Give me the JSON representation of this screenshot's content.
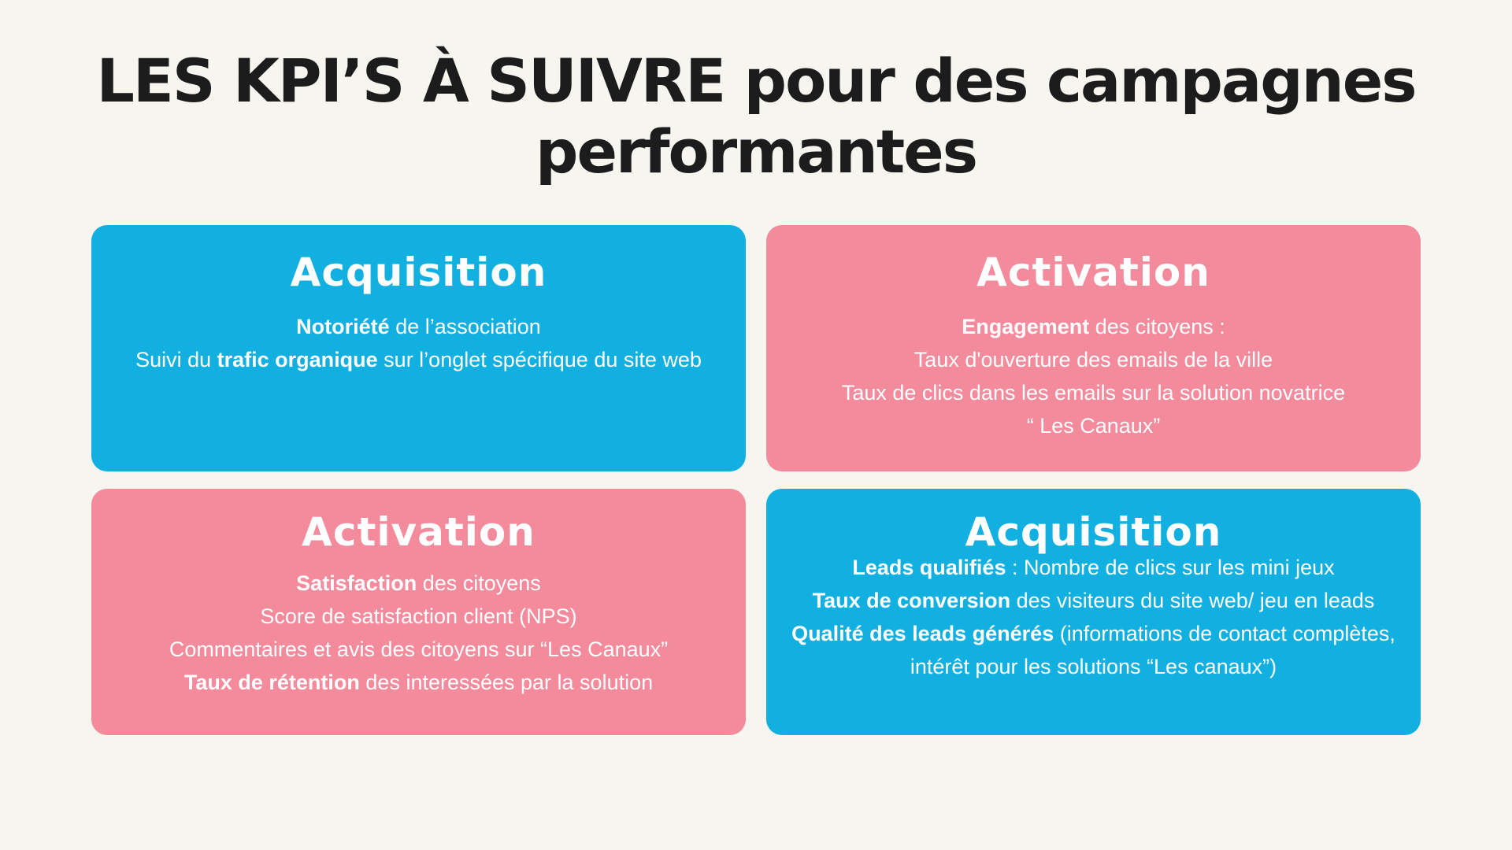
{
  "title": "LES KPI’S À SUIVRE pour des campagnes performantes",
  "cards": [
    {
      "title": "Acquisition",
      "color": "#12b0e0",
      "lines": [
        {
          "bold": "Notoriété",
          "text": " de l’association"
        },
        {
          "pre": "Suivi du ",
          "bold": "trafic organique",
          "text": " sur l’onglet spécifique du site web"
        }
      ]
    },
    {
      "title": "Activation",
      "color": "#f38b9c",
      "lines": [
        {
          "bold": "Engagement",
          "text": " des citoyens :"
        },
        {
          "text": "Taux d'ouverture des emails de la ville"
        },
        {
          "text": "Taux de clics dans les emails sur la solution novatrice"
        },
        {
          "text": "“ Les Canaux”"
        }
      ]
    },
    {
      "title": "Activation",
      "color": "#f38b9c",
      "lines": [
        {
          "bold": "Satisfaction",
          "text": " des citoyens"
        },
        {
          "text": "Score de satisfaction client (NPS)"
        },
        {
          "text": "Commentaires et avis des citoyens sur “Les Canaux”"
        },
        {
          "bold": "Taux de rétention",
          "text": " des interessées par la solution"
        }
      ]
    },
    {
      "title": "Acquisition",
      "color": "#12b0e0",
      "lines": [
        {
          "bold": "Leads qualifiés",
          "text": "  : Nombre de clics sur les mini jeux"
        },
        {
          "bold": "Taux de conversion",
          "text": " des visiteurs du site web/ jeu en leads"
        },
        {
          "bold": "Qualité des leads générés",
          "text": " (informations de contact complètes, intérêt pour les solutions “Les canaux”)"
        }
      ]
    }
  ]
}
